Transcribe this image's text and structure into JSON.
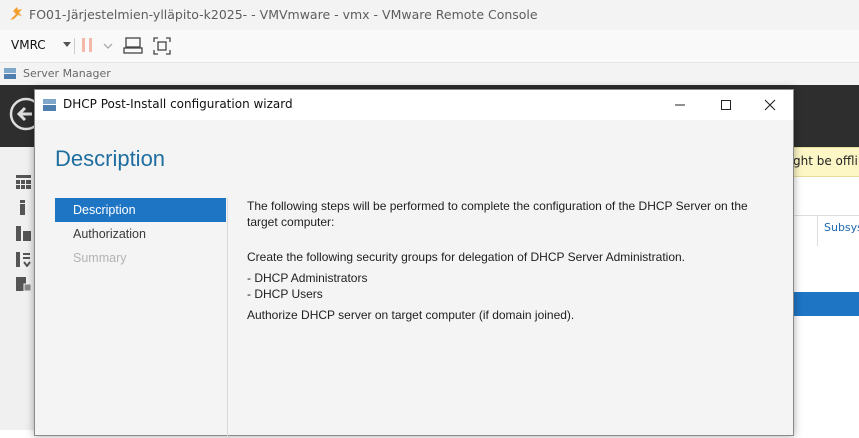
{
  "window": {
    "title": "FO01-Järjestelmien-ylläpito-k2025- - VMVmware - vmx - VMware Remote Console",
    "title_overlay": "VMware"
  },
  "toolbar": {
    "menu_label": "VMRC"
  },
  "server_manager": {
    "title": "Server Manager",
    "notice_text": "ght be offline",
    "column_text": "Subsys"
  },
  "dialog": {
    "title": "DHCP Post-Install configuration wizard",
    "heading": "Description",
    "steps": [
      {
        "label": "Description",
        "state": "active"
      },
      {
        "label": "Authorization",
        "state": "normal"
      },
      {
        "label": "Summary",
        "state": "disabled"
      }
    ],
    "content": {
      "intro": "The following steps will be performed to complete the configuration of the DHCP Server on the target computer:",
      "groups_intro": "Create the following security groups for delegation of DHCP Server Administration.",
      "group1": "- DHCP Administrators",
      "group2": "- DHCP Users",
      "authorize": "Authorize DHCP server on target computer (if domain joined)."
    }
  },
  "colors": {
    "accent": "#1e75c4",
    "heading": "#1f6ea0",
    "dark_header": "#2e2e2e",
    "notice": "#fdf7c6"
  }
}
